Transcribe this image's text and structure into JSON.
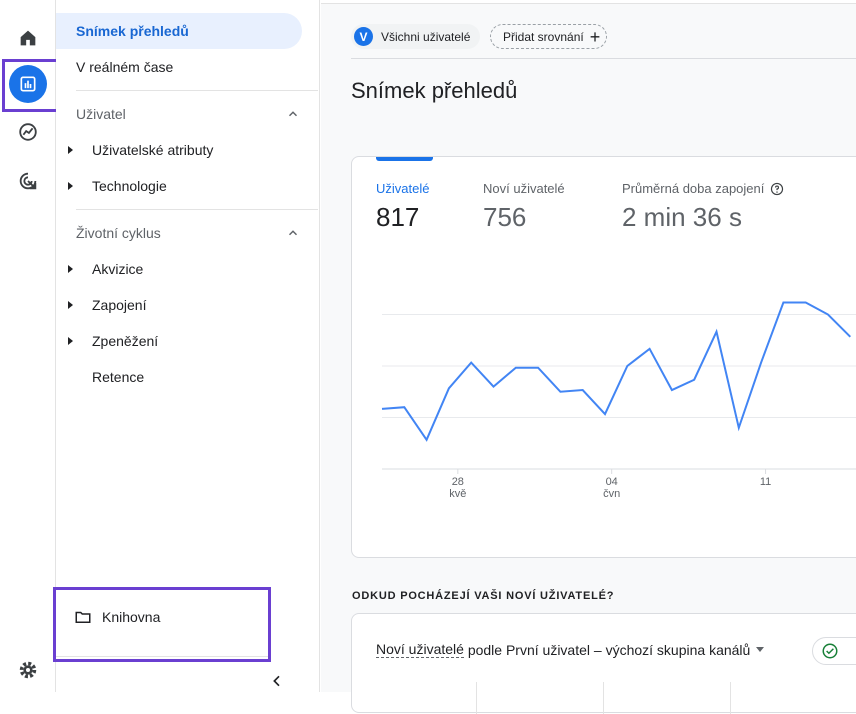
{
  "rail": {
    "items": [
      "home-icon",
      "reports-icon",
      "explore-icon",
      "advertising-icon"
    ],
    "settings": "gear-icon",
    "active": "reports-icon",
    "accent": "#1a73e8",
    "highlight_color": "#6a3fd1"
  },
  "sidenav": {
    "items": {
      "snapshot": "Snímek přehledů",
      "realtime": "V reálném čase",
      "user_section": "Uživatel",
      "user_attributes": "Uživatelské atributy",
      "technology": "Technologie",
      "lifecycle_section": "Životní cyklus",
      "acquisition": "Akvizice",
      "engagement": "Zapojení",
      "monetization": "Zpeněžení",
      "retention": "Retence"
    },
    "library": "Knihovna"
  },
  "header": {
    "segment_avatar": "V",
    "segment_label": "Všichni uživatelé",
    "add_comparison": "Přidat srovnání",
    "add_icon": "+"
  },
  "main": {
    "title": "Snímek přehledů",
    "metrics": [
      {
        "label": "Uživatelé",
        "value": "817"
      },
      {
        "label": "Noví uživatelé",
        "value": "756"
      },
      {
        "label": "Průměrná doba zapojení",
        "value": "2 min 36 s"
      }
    ],
    "section_heading": "ODKUD POCHÁZEJÍ VAŠI NOVÍ UŽIVATELÉ?",
    "card2": {
      "metric_select": "Noví uživatelé",
      "rest": " podle První uživatel – výchozí skupina kanálů"
    }
  },
  "chart_data": {
    "type": "line",
    "x_ticks": [
      {
        "day": "28",
        "month": "kvě"
      },
      {
        "day": "04",
        "month": "čvn"
      },
      {
        "day": "11",
        "month": ""
      }
    ],
    "series": [
      {
        "values": [
          35,
          36,
          17,
          47,
          62,
          48,
          59,
          59,
          45,
          46,
          32,
          60,
          70,
          46,
          52,
          80,
          24,
          62,
          97,
          97,
          90,
          77
        ]
      }
    ],
    "ylim": [
      0,
      120
    ],
    "grid": true,
    "line_color": "#4285f4"
  }
}
